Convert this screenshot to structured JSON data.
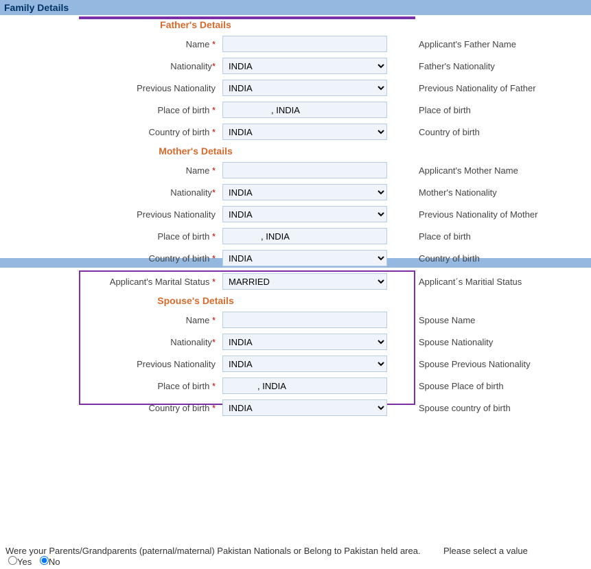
{
  "header": {
    "title": "Family Details"
  },
  "father": {
    "section": "Father's Details",
    "name_label": "Name",
    "name_value": "",
    "name_hint": "Applicant's Father Name",
    "nationality_label": "Nationality",
    "nationality_value": "INDIA",
    "nationality_hint": "Father's Nationality",
    "prev_nat_label": "Previous Nationality",
    "prev_nat_value": "INDIA",
    "prev_nat_hint": "Previous Nationality of Father",
    "pob_label": "Place of birth",
    "pob_value": ", INDIA",
    "pob_hint": "Place of birth",
    "cob_label": "Country of birth",
    "cob_value": "INDIA",
    "cob_hint": "Country of birth"
  },
  "mother": {
    "section": "Mother's Details",
    "name_label": "Name",
    "name_value": "",
    "name_hint": "Applicant's Mother Name",
    "nationality_label": "Nationality",
    "nationality_value": "INDIA",
    "nationality_hint": "Mother's Nationality",
    "prev_nat_label": "Previous Nationality",
    "prev_nat_value": "INDIA",
    "prev_nat_hint": "Previous Nationality of Mother",
    "pob_label": "Place of birth",
    "pob_value": ", INDIA",
    "pob_hint": "Place of birth",
    "cob_label": "Country of birth",
    "cob_value": "INDIA",
    "cob_hint": "Country of birth"
  },
  "marital": {
    "label": "Applicant's Marital Status",
    "value": "MARRIED",
    "hint": "Applicant´s Maritial Status"
  },
  "spouse": {
    "section": "Spouse's Details",
    "name_label": "Name",
    "name_value": "",
    "name_hint": "Spouse Name",
    "nationality_label": "Nationality",
    "nationality_value": "INDIA",
    "nationality_hint": "Spouse Nationality",
    "prev_nat_label": "Previous Nationality",
    "prev_nat_value": "INDIA",
    "prev_nat_hint": "Spouse Previous Nationality",
    "pob_label": "Place of birth",
    "pob_value": ", INDIA",
    "pob_hint": "Spouse Place of birth",
    "cob_label": "Country of birth",
    "cob_value": "INDIA",
    "cob_hint": "Spouse country of birth"
  },
  "pakistan_q": {
    "text": "Were your Parents/Grandparents (paternal/maternal) Pakistan Nationals or Belong to Pakistan held area.",
    "yes": "Yes",
    "no": "No",
    "hint": "Please select a value",
    "selected": "No"
  },
  "star": " *"
}
